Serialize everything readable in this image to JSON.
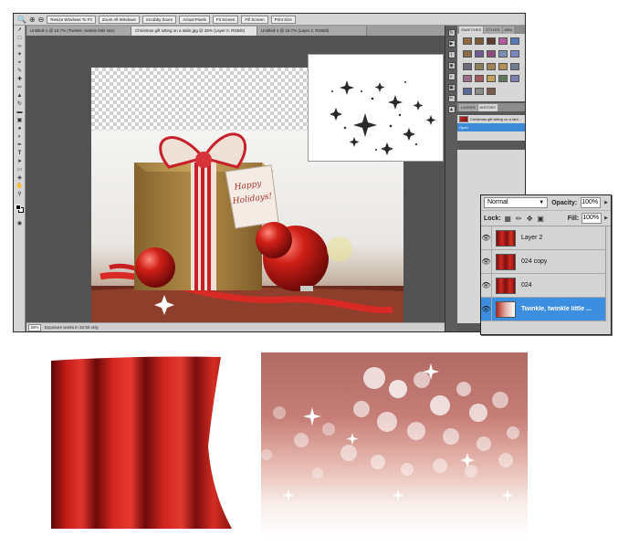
{
  "options_bar": {
    "buttons": [
      "Resize Windows To Fit",
      "Zoom All Windows",
      "Scrubby Zoom",
      "Actual Pixels",
      "Fit Screen",
      "Fill Screen",
      "Print Size"
    ]
  },
  "document_tabs": [
    "Untitled-1 @ 16.7% (Twinkle, twinkle little star)",
    "Christmas gift sitting on a table.jpg @ 25% (Layer 0, RGB/8)",
    "Untitled-1 @ 16.7% (Layer 2, RGB/8)"
  ],
  "status_bar": {
    "zoom": "25%",
    "info": "Exposure works in 32-bit only"
  },
  "right_panel": {
    "tabs": [
      "SWATCHES",
      "STYLES",
      "MINI"
    ],
    "swatch_colors": [
      "#8f6a3f",
      "#7b5a3a",
      "#5a3a2d",
      "#b25b9a",
      "#5976b8",
      "#8a6c48",
      "#6e5a8f",
      "#8b4e7d",
      "#7f8fb2",
      "#7b86c0",
      "#6f6a7a",
      "#8c7f5a",
      "#a08455",
      "#b68f56",
      "#6f7f8f",
      "#9a6f8e",
      "#a05a5a",
      "#c0a05a",
      "#5f7a5a",
      "#7a7fb0",
      "#5a6a9a",
      "#8a8a8a",
      "#7a5a4a"
    ],
    "history_tabs": [
      "LAYERS",
      "HISTORY"
    ],
    "history_items": [
      "Christmas gift sitting on a tabl...",
      "Open"
    ]
  },
  "layers_panel": {
    "blend_mode": "Normal",
    "opacity_label": "Opacity:",
    "opacity_value": "100%",
    "lock_label": "Lock:",
    "fill_label": "Fill:",
    "fill_value": "100%",
    "layers": [
      {
        "name": "Layer 2",
        "visible": true,
        "selected": false
      },
      {
        "name": "024 copy",
        "visible": true,
        "selected": false
      },
      {
        "name": "024",
        "visible": true,
        "selected": false
      },
      {
        "name": "Twinkle, twinkle little ...",
        "visible": true,
        "selected": true
      }
    ]
  },
  "photo": {
    "tag_text_line1": "Happy",
    "tag_text_line2": "Holidays!"
  }
}
